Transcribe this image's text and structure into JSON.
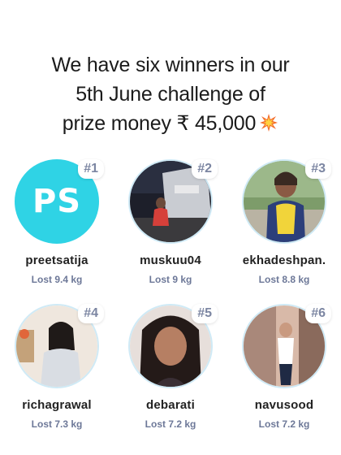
{
  "headline": {
    "line1": "We have six winners in our",
    "line2": "5th June challenge of",
    "line3": "prize money ₹ 45,000",
    "icon": "collision-icon"
  },
  "winners": [
    {
      "rank": "#1",
      "username": "preetsatija",
      "lost": "Lost 9.4 kg",
      "initials": "PS",
      "avatar_color": "#2fd3e5"
    },
    {
      "rank": "#2",
      "username": "muskuu04",
      "lost": "Lost 9 kg"
    },
    {
      "rank": "#3",
      "username": "ekhadeshpan.",
      "lost": "Lost 8.8 kg"
    },
    {
      "rank": "#4",
      "username": "richagrawal",
      "lost": "Lost 7.3 kg"
    },
    {
      "rank": "#5",
      "username": "debarati",
      "lost": "Lost 7.2 kg"
    },
    {
      "rank": "#6",
      "username": "navusood",
      "lost": "Lost 7.2 kg"
    }
  ],
  "colors": {
    "badge_text": "#7c86a2",
    "weight_text": "#6d7898",
    "initials_bg": "#2fd3e5"
  }
}
